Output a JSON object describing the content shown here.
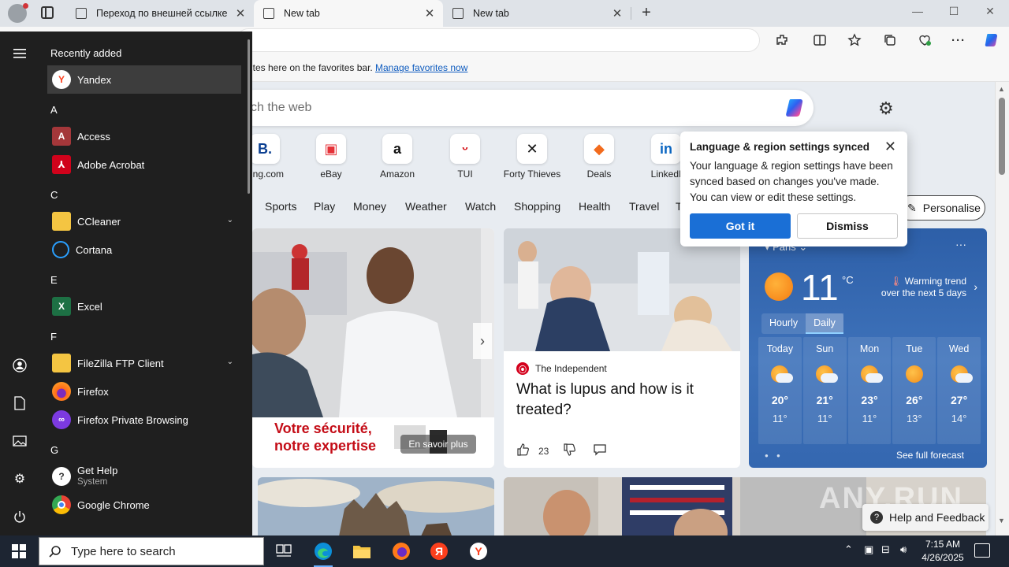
{
  "browser": {
    "tabs": [
      {
        "title": "Переход по внешней ссылке",
        "close": "✕"
      },
      {
        "title": "New tab",
        "close": "✕"
      },
      {
        "title": "New tab",
        "close": "✕"
      }
    ],
    "new_tab": "+",
    "window_controls": {
      "minimize": "—",
      "maximize": "☐",
      "close": "✕"
    },
    "favorites_bar": {
      "text": "ites here on the favorites bar.",
      "link": "Manage favorites now"
    }
  },
  "newtab": {
    "search_placeholder": "ch the web",
    "quick_links": [
      {
        "label": "king.com",
        "glyph": "B.",
        "color": "#0b3f91"
      },
      {
        "label": "eBay",
        "glyph": "▣",
        "color": "#e53238"
      },
      {
        "label": "Amazon",
        "glyph": "a",
        "color": "#111111"
      },
      {
        "label": "TUI",
        "glyph": "ᵕ",
        "color": "#d40e14"
      },
      {
        "label": "Forty Thieves",
        "glyph": "✕",
        "color": "#111111"
      },
      {
        "label": "Deals",
        "glyph": "◆",
        "color": "#f26b1d"
      },
      {
        "label": "LinkedI",
        "glyph": "in",
        "color": "#0a66c2"
      }
    ],
    "categories": [
      "Sports",
      "Play",
      "Money",
      "Weather",
      "Watch",
      "Shopping",
      "Health",
      "Travel",
      "T"
    ],
    "personalise": "Personalise",
    "ad": {
      "line1": "Votre sécurité,",
      "line2": "notre expertise",
      "cta": "En savoir plus"
    },
    "news": {
      "source": "The Independent",
      "title": "What is lupus and how is it treated?",
      "likes": "23"
    },
    "weather": {
      "location": "Paris",
      "temp": "11",
      "unit": "°C",
      "trend_line1": "Warming trend",
      "trend_line2": "over the next 5 days",
      "tabs": [
        "Hourly",
        "Daily"
      ],
      "days": [
        {
          "day": "Today",
          "hi": "20°",
          "lo": "11°",
          "icon": "partly-cloudy"
        },
        {
          "day": "Sun",
          "hi": "21°",
          "lo": "11°",
          "icon": "partly-cloudy"
        },
        {
          "day": "Mon",
          "hi": "23°",
          "lo": "11°",
          "icon": "partly-cloudy"
        },
        {
          "day": "Tue",
          "hi": "26°",
          "lo": "13°",
          "icon": "sunny"
        },
        {
          "day": "Wed",
          "hi": "27°",
          "lo": "14°",
          "icon": "partly-cloudy"
        }
      ],
      "full_forecast": "See full forecast"
    },
    "help_feedback": "Help and Feedback",
    "watermark": "ANY.RUN"
  },
  "popup": {
    "title": "Language & region settings synced",
    "body": "Your language & region settings have been synced based on changes you've made. You can view or edit these settings.",
    "primary": "Got it",
    "secondary": "Dismiss"
  },
  "start_menu": {
    "recently_added": "Recently added",
    "yandex": "Yandex",
    "sections": [
      {
        "letter": "A",
        "apps": [
          {
            "name": "Access"
          },
          {
            "name": "Adobe Acrobat"
          }
        ]
      },
      {
        "letter": "C",
        "apps": [
          {
            "name": "CCleaner"
          },
          {
            "name": "Cortana"
          }
        ]
      },
      {
        "letter": "E",
        "apps": [
          {
            "name": "Excel"
          }
        ]
      },
      {
        "letter": "F",
        "apps": [
          {
            "name": "FileZilla FTP Client"
          },
          {
            "name": "Firefox"
          },
          {
            "name": "Firefox Private Browsing"
          }
        ]
      },
      {
        "letter": "G",
        "apps": [
          {
            "name": "Get Help",
            "sub": "System"
          },
          {
            "name": "Google Chrome"
          }
        ]
      }
    ]
  },
  "taskbar": {
    "search_placeholder": "Type here to search",
    "time": "7:15 AM",
    "date": "4/26/2025"
  },
  "colors": {
    "accent": "#1a6fd6",
    "start_menu_bg": "#1f1f1f",
    "taskbar_bg": "#1d2532",
    "weather_bg": "#2d5fa8"
  }
}
